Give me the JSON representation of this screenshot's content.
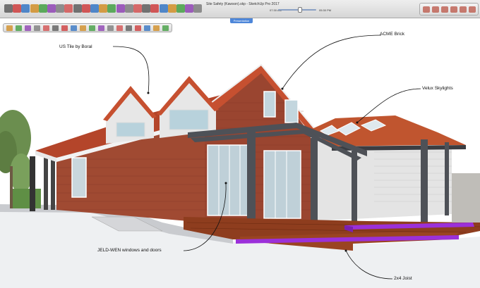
{
  "window": {
    "title": "Site Safety (Kawson).skp - SketchUp Pro 2017"
  },
  "toolbar": {
    "time_start": "07:30 AM",
    "time_end": "05:30 PM",
    "tools": [
      "select-icon",
      "eraser-icon",
      "pencil-icon",
      "arc-icon",
      "shape-icon",
      "push-pull-icon",
      "move-icon",
      "rotate-icon",
      "scale-icon",
      "offset-icon",
      "tape-measure-icon",
      "text-icon",
      "protractor-icon",
      "paint-bucket-icon",
      "orbit-icon",
      "pan-icon",
      "zoom-icon",
      "zoom-extents-icon",
      "warehouse-icon",
      "extension-icon",
      "layout-icon",
      "shadow-icon",
      "style-icon"
    ]
  },
  "scene_tab": {
    "label": "Presentation"
  },
  "annotations": {
    "tile": "US Tile by Boral",
    "brick": "ACME Brick",
    "skylights": "Velux Skylights",
    "windows": "JELD-WEN windows and doors",
    "joist": "2x4 Joist"
  },
  "colors": {
    "roof": "#b4452a",
    "brick": "#a04a32",
    "deck": "#8e3d1e",
    "highlight": "#9b30d9",
    "pergola": "#4e5157",
    "scene_tab": "#4d86d9"
  }
}
